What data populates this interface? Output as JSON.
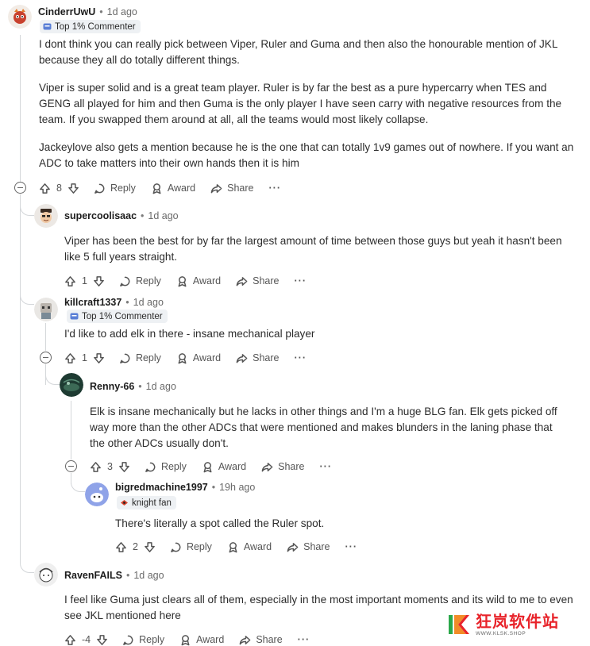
{
  "actions": {
    "reply": "Reply",
    "award": "Award",
    "share": "Share",
    "more": "···"
  },
  "comments": [
    {
      "author": "CinderrUwU",
      "time": "1d ago",
      "flair": "Top 1% Commenter",
      "paragraphs": [
        "I dont think you can really pick between Viper, Ruler and Guma and then also the honourable mention of JKL because they all do totally different things.",
        "Viper is super solid and is a great team player. Ruler is by far the best as a pure hypercarry when TES and GENG all played for him and then Guma is the only player I have seen carry with negative resources from the team. If you swapped them around at all, all the teams would most likely collapse.",
        "Jackeylove also gets a mention because he is the one that can totally 1v9 games out of nowhere. If you want an ADC to take matters into their own hands then it is him"
      ],
      "score": "8"
    },
    {
      "author": "supercoolisaac",
      "time": "1d ago",
      "paragraphs": [
        "Viper has been the best for by far the largest amount of time between those guys but yeah it hasn't been like 5 full years straight."
      ],
      "score": "1"
    },
    {
      "author": "killcraft1337",
      "time": "1d ago",
      "flair": "Top 1% Commenter",
      "paragraphs": [
        "I'd like to add elk in there - insane mechanical player"
      ],
      "score": "1"
    },
    {
      "author": "Renny-66",
      "time": "1d ago",
      "paragraphs": [
        "Elk is insane mechanically but he lacks in other things and I'm a huge BLG fan. Elk gets picked off way more than the other ADCs that were mentioned and makes blunders in the laning phase that the other ADCs usually don't."
      ],
      "score": "3"
    },
    {
      "author": "bigredmachine1997",
      "time": "19h ago",
      "flair": "knight fan",
      "paragraphs": [
        "There's literally a spot called the Ruler spot."
      ],
      "score": "2"
    },
    {
      "author": "RavenFAILS",
      "time": "1d ago",
      "paragraphs": [
        "I feel like Guma just clears all of them, especially in the most important moments and its wild to me to even see JKL mentioned here"
      ],
      "score": "-4"
    }
  ],
  "watermark": {
    "title": "狂岚软件站",
    "subtitle": "WWW.KLSK.SHOP"
  },
  "colors": {
    "text": "#1c1c1c",
    "muted": "#6a6a6a",
    "flair_bg": "#eef1f4",
    "thread_line": "#d4d7da",
    "watermark_red": "#e8232a"
  }
}
